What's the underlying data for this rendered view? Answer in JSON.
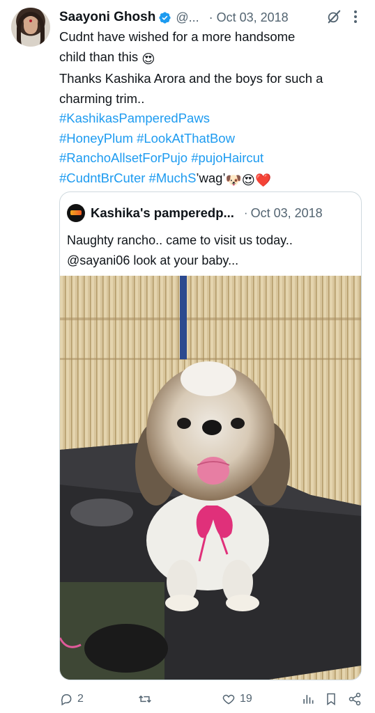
{
  "tweet": {
    "author_name": "Saayoni Ghosh",
    "handle": "@...",
    "separator": "·",
    "date": "Oct 03, 2018",
    "lines": [
      {
        "text": "Cudnt have wished for a more handsome"
      },
      {
        "text": "child than this "
      },
      {
        "text": "Thanks Kashika Arora and the boys for such a"
      },
      {
        "text": "charming trim.."
      }
    ],
    "hashtags": {
      "line1": "#KashikasPamperedPaws",
      "line2a": "#HoneyPlum",
      "line2b": "#LookAtThatBow",
      "line3a": "#RanchoAllsetForPujo",
      "line3b": "#pujoHaircut",
      "line4a": "#CudntBrCuter",
      "line4b": "#MuchS",
      "line4_suffix": "’wag’"
    },
    "emojis": {
      "heart_eyes": "😍",
      "dog": "🐶",
      "red_heart": "❤️"
    }
  },
  "quote": {
    "author_name": "Kashika's pamperedp...",
    "separator": "·",
    "date": "Oct 03, 2018",
    "line1": "Naughty rancho.. came to visit us today..",
    "line2": "@sayani06  look at your baby..."
  },
  "actions": {
    "reply_count": "2",
    "like_count": "19"
  },
  "colors": {
    "link": "#1d9bf0",
    "muted": "#536471",
    "verified": "#1d9bf0",
    "border": "#cfd9de"
  },
  "icons": [
    "verified-badge-icon",
    "grok-icon",
    "more-icon",
    "reply-icon",
    "retweet-icon",
    "like-icon",
    "views-icon",
    "bookmark-icon",
    "share-icon"
  ]
}
